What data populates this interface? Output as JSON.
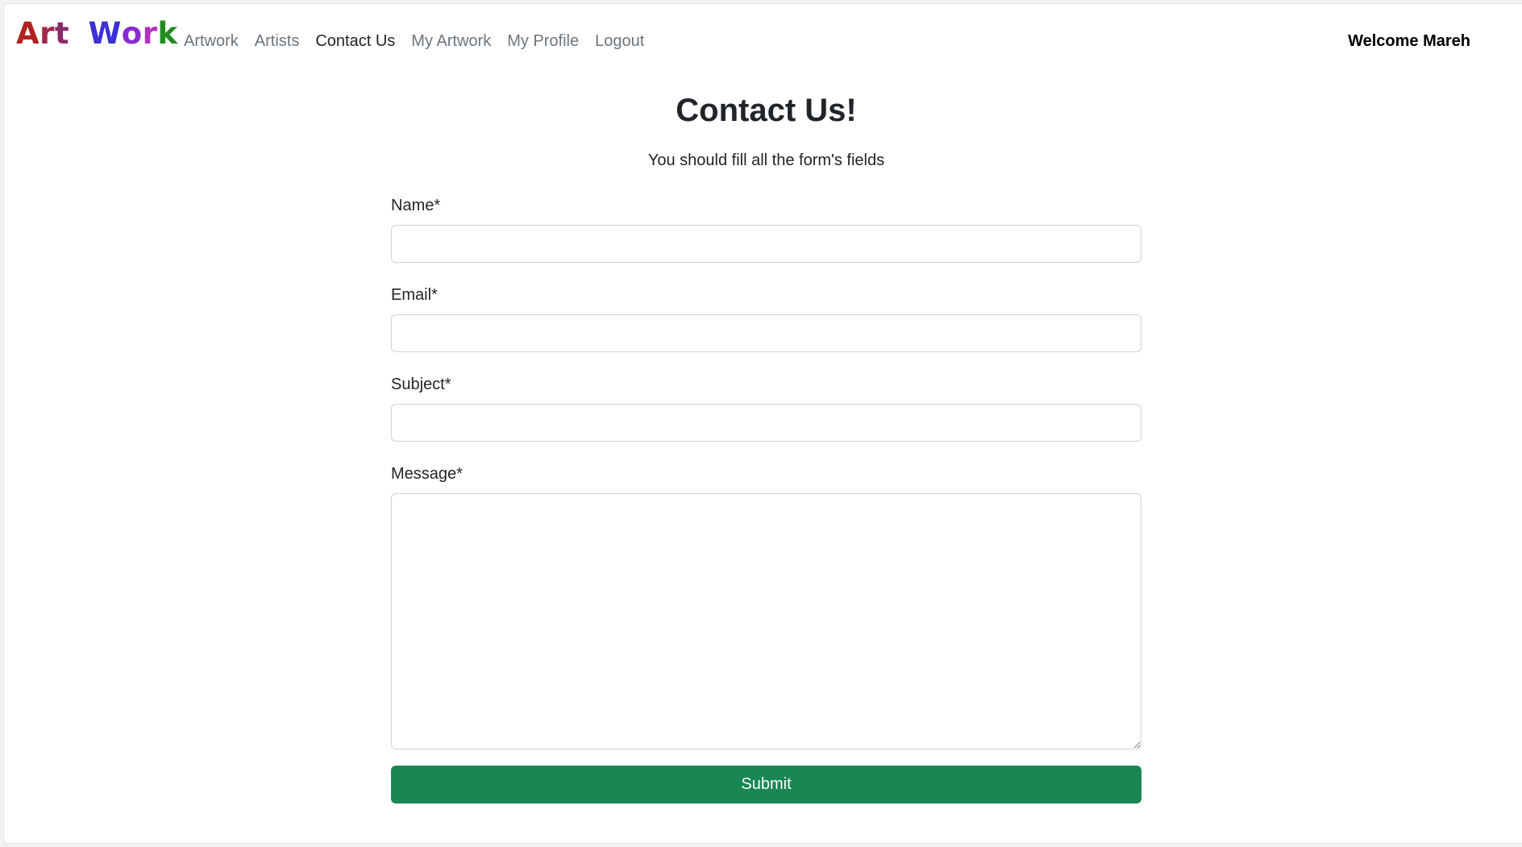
{
  "brand": {
    "words": [
      {
        "letters": [
          {
            "char": "A",
            "color": "#b22222"
          },
          {
            "char": "r",
            "color": "#a0284a"
          },
          {
            "char": "t",
            "color": "#8a2a6a"
          }
        ]
      },
      {
        "letters": [
          {
            "char": "W",
            "color": "#3b2fd6"
          },
          {
            "char": "o",
            "color": "#8a2bd1"
          },
          {
            "char": "r",
            "color": "#b030c0"
          },
          {
            "char": "k",
            "color": "#228b22"
          }
        ]
      }
    ]
  },
  "nav": {
    "items": [
      {
        "label": "Artwork",
        "active": false
      },
      {
        "label": "Artists",
        "active": false
      },
      {
        "label": "Contact Us",
        "active": true
      },
      {
        "label": "My Artwork",
        "active": false
      },
      {
        "label": "My Profile",
        "active": false
      },
      {
        "label": "Logout",
        "active": false
      }
    ],
    "welcome": "Welcome Mareh"
  },
  "form": {
    "title": "Contact Us!",
    "subtitle": "You should fill all the form's fields",
    "name_label": "Name*",
    "name_value": "",
    "email_label": "Email*",
    "email_value": "",
    "subject_label": "Subject*",
    "subject_value": "",
    "message_label": "Message*",
    "message_value": "",
    "submit_label": "Submit"
  },
  "colors": {
    "submit": "#198754",
    "nav_inactive": "#6c757d",
    "nav_active": "#212529"
  }
}
